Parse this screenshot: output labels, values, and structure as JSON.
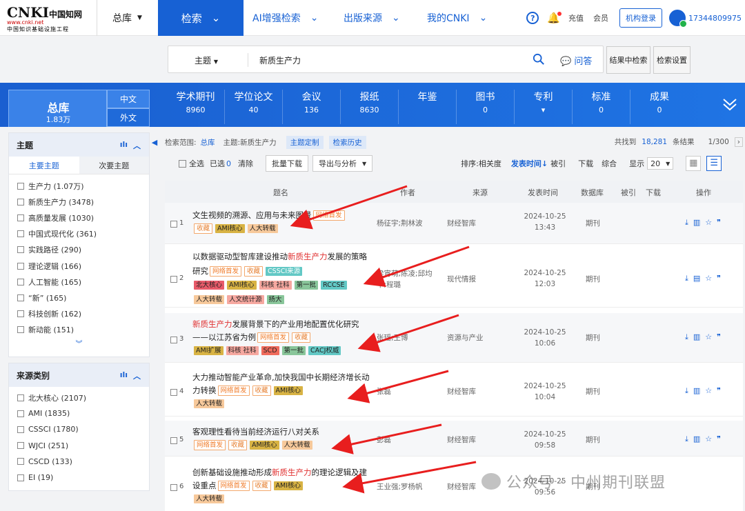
{
  "header": {
    "logo_big": "CNKI",
    "logo_cn": "中国知网",
    "logo_url": "www.cnki.net",
    "logo_sub": "中国知识基础设施工程",
    "db": "总库",
    "nav": [
      "检索",
      "AI增强检索",
      "出版来源",
      "我的CNKI"
    ],
    "recharge": "充值",
    "member": "会员",
    "org_login": "机构登录",
    "user": "17344809975",
    "help": "?"
  },
  "search": {
    "field": "主题",
    "value": "新质生产力",
    "ask": "问答",
    "in_results": "结果中检索",
    "settings": "检索设置"
  },
  "cats": {
    "zongku": "总库",
    "zongku_count": "1.83万",
    "zh": "中文",
    "en": "外文",
    "items": [
      {
        "t": "学术期刊",
        "c": "8960"
      },
      {
        "t": "学位论文",
        "c": "40"
      },
      {
        "t": "会议",
        "c": "136"
      },
      {
        "t": "报纸",
        "c": "8630"
      },
      {
        "t": "年鉴",
        "c": ""
      },
      {
        "t": "图书",
        "c": "0"
      },
      {
        "t": "专利",
        "c": ""
      },
      {
        "t": "标准",
        "c": "0"
      },
      {
        "t": "成果",
        "c": "0"
      }
    ]
  },
  "topic_panel": {
    "title": "主题",
    "tab_main": "主要主题",
    "tab_sub": "次要主题",
    "items": [
      "生产力 (1.07万)",
      "新质生产力 (3478)",
      "高质量发展 (1030)",
      "中国式现代化 (361)",
      "实践路径 (290)",
      "理论逻辑 (166)",
      "人工智能 (165)",
      "“新” (165)",
      "科技创新 (162)",
      "新动能 (151)"
    ]
  },
  "source_panel": {
    "title": "来源类别",
    "items": [
      "北大核心 (2107)",
      "AMI (1835)",
      "CSSCI (1780)",
      "WJCI (251)",
      "CSCD (133)",
      "EI (19)"
    ]
  },
  "crumbs": {
    "label": "检索范围:",
    "scope": "总库",
    "topic": "主题:新质生产力",
    "chip1": "主题定制",
    "chip2": "检索历史",
    "found": "共找到",
    "total": "18,281",
    "unit": "条结果",
    "page": "1/300"
  },
  "toolbar": {
    "select_all": "全选",
    "selected": "已选",
    "sel_count": "0",
    "clear": "清除",
    "batch": "批量下载",
    "export": "导出与分析",
    "sort_label": "排序:",
    "relevance": "相关度",
    "pubtime": "发表时间",
    "cited": "被引",
    "download": "下载",
    "compo": "综合",
    "show": "显示",
    "per_page": "20"
  },
  "thead": {
    "title": "题名",
    "author": "作者",
    "source": "来源",
    "date": "发表时间",
    "db": "数据库",
    "cited": "被引",
    "dl": "下载",
    "op": "操作"
  },
  "rows": [
    {
      "n": "1",
      "pre": "文生视频的溯源、应用与未来图景",
      "hl": "",
      "post": "",
      "author": "杨征宇;荆林波",
      "source": "财经智库",
      "date": "2024-10-25",
      "time": "13:43",
      "db": "期刊"
    },
    {
      "n": "2",
      "pre": "以数据驱动型智库建设推动",
      "hl": "新质生产力",
      "post": "发展的策略研究",
      "author": "梁宵萌;陈凌;邱均平;程璐",
      "source": "现代情报",
      "date": "2024-10-25",
      "time": "12:03",
      "db": "期刊"
    },
    {
      "n": "3",
      "pre": "",
      "hl": "新质生产力",
      "post": "发展背景下的产业用地配置优化研究——以江苏省为例",
      "author": "张瑶;王博",
      "source": "资源与产业",
      "date": "2024-10-25",
      "time": "10:06",
      "db": "期刊"
    },
    {
      "n": "4",
      "pre": "大力推动智能产业革命,加快我国中长期经济增长动力转换",
      "hl": "",
      "post": "",
      "author": "张磊",
      "source": "财经智库",
      "date": "2024-10-25",
      "time": "10:04",
      "db": "期刊"
    },
    {
      "n": "5",
      "pre": "客观理性看待当前经济运行八对关系",
      "hl": "",
      "post": "",
      "author": "彭磊",
      "source": "财经智库",
      "date": "2024-10-25",
      "time": "09:58",
      "db": "期刊"
    },
    {
      "n": "6",
      "pre": "创新基础设施推动形成",
      "hl": "新质生产力",
      "post": "的理论逻辑及建设重点",
      "author": "王业强;罗杨帆",
      "source": "财经智库",
      "date": "2024-10-25",
      "time": "09:56",
      "db": "期刊"
    }
  ],
  "tags": {
    "net": "网络首发",
    "fav": "收藏",
    "ami": "AMI核心",
    "ren": "人大转载",
    "cssci": "CSSCI来源",
    "bd": "北大核心",
    "ami2": "AMI核心",
    "kj": "科核 社科",
    "dyp": "第一批",
    "rcc": "RCCSE",
    "rw": "人文统计源",
    "yd": "扬大",
    "amik": "AMI扩展",
    "kj2": "科核 社科",
    "scd": "SCD",
    "dyp2": "第一批",
    "cacj": "CACJ权威"
  },
  "watermark": "公众号 · 中州期刊联盟"
}
